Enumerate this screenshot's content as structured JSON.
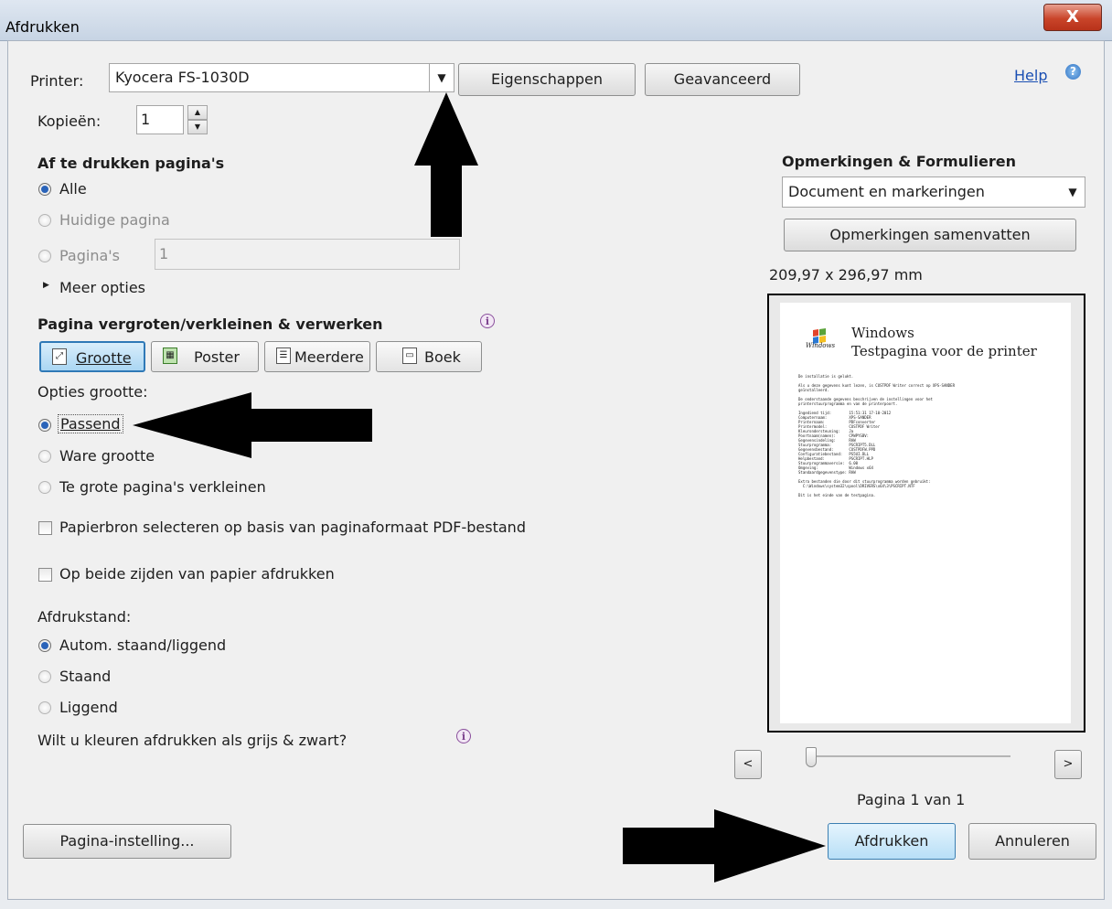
{
  "window": {
    "title": "Afdrukken",
    "close_label": "X"
  },
  "printer": {
    "label": "Printer:",
    "selected": "Kyocera FS-1030D",
    "properties_button": "Eigenschappen",
    "advanced_button": "Geavanceerd",
    "help_link": "Help",
    "copies_label": "Kopieën:",
    "copies_value": "1"
  },
  "pages": {
    "heading": "Af te drukken pagina's",
    "all_label": "Alle",
    "current_label": "Huidige pagina",
    "pages_label": "Pagina's",
    "pages_value": "1",
    "more_options": "Meer opties"
  },
  "sizing": {
    "heading": "Pagina vergroten/verkleinen & verwerken",
    "tabs": [
      "Grootte",
      "Poster",
      "Meerdere",
      "Boek"
    ],
    "options_label": "Opties grootte:",
    "fit_label": "Passend",
    "actual_label": "Ware grootte",
    "shrink_label": "Te grote pagina's verkleinen",
    "paper_source_label": "Papierbron selecteren op basis van paginaformaat PDF-bestand",
    "duplex_label": "Op beide zijden van papier afdrukken"
  },
  "orientation": {
    "label": "Afdrukstand:",
    "auto_label": "Autom. staand/liggend",
    "portrait_label": "Staand",
    "landscape_label": "Liggend"
  },
  "grayscale_question": "Wilt u kleuren afdrukken als grijs & zwart?",
  "comments": {
    "heading": "Opmerkingen & Formulieren",
    "selected": "Document en markeringen",
    "summarize_button": "Opmerkingen samenvatten"
  },
  "preview": {
    "dimensions": "209,97 x 296,97 mm",
    "logo_text": "Windows",
    "title_line1": "Windows",
    "title_line2": "Testpagina voor de printer",
    "body_lines": [
      "De installatie is gelukt.",
      "",
      "Als u deze gegevens kunt lezen, is CUSTPDF Writer correct op XPS-SANDER",
      "geïnstalleerd.",
      "",
      "De onderstaande gegevens beschrijven de instellingen voor het",
      "printerstuurprogramma en van de printerpoort.",
      "",
      "Ingediend tijd:        15:51:31 17-10-2012",
      "Computernaam:          XPS-SANDER",
      "Printernaam:           PDFconverter",
      "Printermodel:          CUSTPDF Writer",
      "Kleurondersteuning:    Ja",
      "Poortnaam(namen):      CPWPYSBV:",
      "Gegevensindeling:      RAW",
      "Stuurprogramma:        PSCRIPT5.DLL",
      "Gegevensbestand:       CUSTPDFW.PPD",
      "Configuratiebestand:   PS5UI.DLL",
      "Helpbestand:           PSCRIPT.HLP",
      "Stuurprogrammaversie:  6.00",
      "Omgeving:              Windows x64",
      "Standaardgegevenstype: RAW",
      "",
      "Extra bestanden die door dit stuurprogramma worden gebruikt:",
      "  C:\\Windows\\system32\\spool\\DRIVERS\\x64\\3\\PSCRIPT.NTF",
      "",
      "Dit is het einde van de testpagina."
    ],
    "prev_label": "<",
    "next_label": ">",
    "page_indicator": "Pagina 1 van 1",
    "slider_level": 0
  },
  "buttons": {
    "page_setup": "Pagina-instelling...",
    "print": "Afdrukken",
    "cancel": "Annuleren"
  },
  "icons": {
    "help": "help-icon",
    "info": "info-icon",
    "expand": "triangle-right-icon",
    "annotation_arrow": "black-arrow-icon"
  },
  "colors": {
    "accent": "#2f79b7",
    "arrow": "#000000"
  }
}
